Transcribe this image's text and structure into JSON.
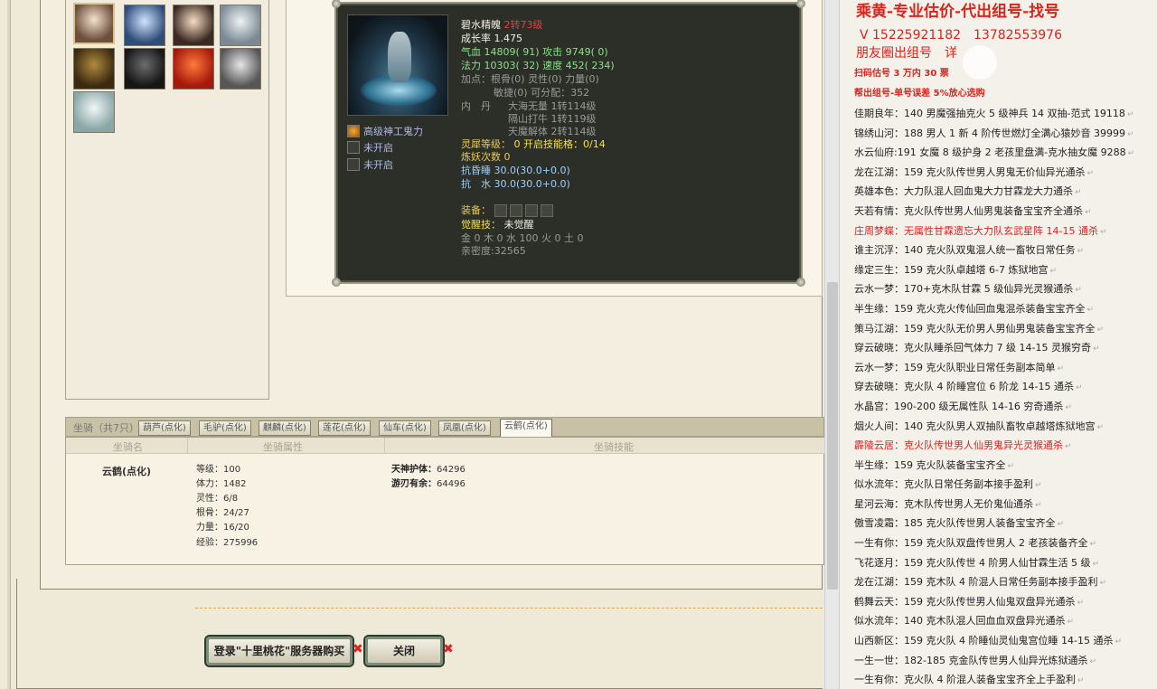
{
  "pet": {
    "name": "碧水精魄",
    "rebirth": "2转73级",
    "growth": "成长率 1.475",
    "hp_label": "气血",
    "hp_value": "14809( 91)",
    "attack": "攻击 9749( 0)",
    "mp_label": "法力",
    "mp_value": "10303( 32)",
    "speed": "速度 452( 234)",
    "points_line1": "加点：根骨(0) 灵性(0) 力量(0)",
    "points_line2": "敏捷(0) 可分配：352",
    "neidan_label": "内　丹",
    "neidan_1": "大海无量 1转114级",
    "neidan_2": "隔山打牛 1转119级",
    "neidan_3": "天魔解体 2转114级",
    "spirit_label": "灵犀等级：",
    "spirit_value": "0 开启技能格：0/14",
    "refine": "炼妖次数 0",
    "resist_sleep_label": "抗昏睡",
    "resist_sleep_value": "30.0(30.0+0.0)",
    "resist_water_label": "抗　水",
    "resist_water_value": "30.0(30.0+0.0)",
    "equip_label": "装备：",
    "awaken_label": "觉醒技：",
    "awaken_value": "未觉醒",
    "elements": "金 0 木 0 水 100 火 0 土 0",
    "intimacy": "亲密度:32565"
  },
  "skills": [
    {
      "label": "高级神工鬼力",
      "active": true
    },
    {
      "label": "未开启",
      "active": false
    },
    {
      "label": "未开启",
      "active": false
    }
  ],
  "mount": {
    "section_title": "坐骑（共7只）",
    "tabs": [
      "葫芦(点化)",
      "毛驴(点化)",
      "麒麟(点化)",
      "莲花(点化)",
      "仙车(点化)",
      "凤凰(点化)",
      "云鹤(点化)"
    ],
    "active_tab": "云鹤(点化)",
    "col_name": "坐骑名",
    "col_attr": "坐骑属性",
    "col_skill": "坐骑技能",
    "name": "云鹤(点化)",
    "stats": [
      "等级：100",
      "体力：1482",
      "灵性：6/8",
      "根骨：24/27",
      "力量：16/20",
      "经验：275996"
    ],
    "skills": [
      {
        "label": "天神护体：",
        "value": "64296"
      },
      {
        "label": "游刃有余：",
        "value": "64496"
      }
    ]
  },
  "buttons": {
    "login": "登录\"十里桃花\"服务器购买",
    "close": "关闭"
  },
  "sidebar": {
    "title": "乘黄-专业估价-代出组号-找号",
    "phone": "V 15225921182　13782553976",
    "moments": "朋友圈出组号　详",
    "scan": "扫码估号 3 万内 30 票",
    "help": "帮出组号-单号误差 5%放心选购",
    "listings": [
      {
        "text": "佳期良年：140 男魔强抽克火 5 级神兵 14 双抽-范式 19118",
        "red": false
      },
      {
        "text": "锦绣山河：188 男人 1 新 4 阶传世燃灯全满心猿妙音 39999",
        "red": false
      },
      {
        "text": "水云仙府:191 女魔 8 级护身 2 老孩里盘满-克水抽女魔 9288",
        "red": false
      },
      {
        "text": "龙在江湖：159 克火队传世男人男鬼无价仙异光通杀",
        "red": false
      },
      {
        "text": "英雄本色：大力队混人回血鬼大力甘霖龙大力通杀",
        "red": false
      },
      {
        "text": "天若有情：克火队传世男人仙男鬼装备宝宝齐全通杀",
        "red": false
      },
      {
        "text": "庄周梦蝶：无属性甘霖遗忘大力队玄武星阵 14-15 通杀",
        "red": true
      },
      {
        "text": "谁主沉浮：140 克火队双鬼混人统一畜牧日常任务",
        "red": false
      },
      {
        "text": "缘定三生：159 克火队卓越塔 6-7 炼狱地宫",
        "red": false
      },
      {
        "text": "云水一梦：170+克木队甘霖 5 级仙异光灵猴通杀",
        "red": false
      },
      {
        "text": "半生缘：159 克火克火传仙回血鬼混杀装备宝宝齐全",
        "red": false
      },
      {
        "text": "策马江湖：159 克火队无价男人男仙男鬼装备宝宝齐全",
        "red": false
      },
      {
        "text": "穿云破晓：克火队睡杀回气体力 7 级 14-15 灵猴穷奇",
        "red": false
      },
      {
        "text": "云水一梦：159 克火队职业日常任务副本简单",
        "red": false
      },
      {
        "text": "穿去破晓：克火队 4 阶睡宫位 6 阶龙 14-15 通杀",
        "red": false
      },
      {
        "text": "水晶宫：190-200 级无属性队 14-16 穷奇通杀",
        "red": false
      },
      {
        "text": "烟火人间：140 克火队男人双抽队畜牧卓越塔炼狱地宫",
        "red": false
      },
      {
        "text": "霹陵云居：克火队传世男人仙男鬼异光灵猴通杀",
        "red": true
      },
      {
        "text": "半生缘：159 克火队装备宝宝齐全",
        "red": false
      },
      {
        "text": "似水流年：克火队日常任务副本接手盈利",
        "red": false
      },
      {
        "text": "星河云海：克木队传世男人无价鬼仙通杀",
        "red": false
      },
      {
        "text": "傲雪凌霜：185 克火队传世男人装备宝宝齐全",
        "red": false
      },
      {
        "text": "一生有你：159 克火队双盘传世男人 2 老孩装备齐全",
        "red": false
      },
      {
        "text": "飞花逐月：159 克火队传世 4 阶男人仙甘霖生活 5 级",
        "red": false
      },
      {
        "text": "龙在江湖：159 克木队 4 阶混人日常任务副本接手盈利",
        "red": false
      },
      {
        "text": "鹤舞云天：159 克火队传世男人仙鬼双盘异光通杀",
        "red": false
      },
      {
        "text": "似水流年：140 克木队混人回血血双盘异光通杀",
        "red": false
      },
      {
        "text": "山西新区：159 克火队 4 阶睡仙灵仙鬼宫位睡 14-15 通杀",
        "red": false
      },
      {
        "text": "一生一世：182-185 克金队传世男人仙异光炼狱通杀",
        "red": false
      },
      {
        "text": "一生有你：克火队 4 阶混人装备宝宝齐全上手盈利",
        "red": false
      }
    ]
  }
}
